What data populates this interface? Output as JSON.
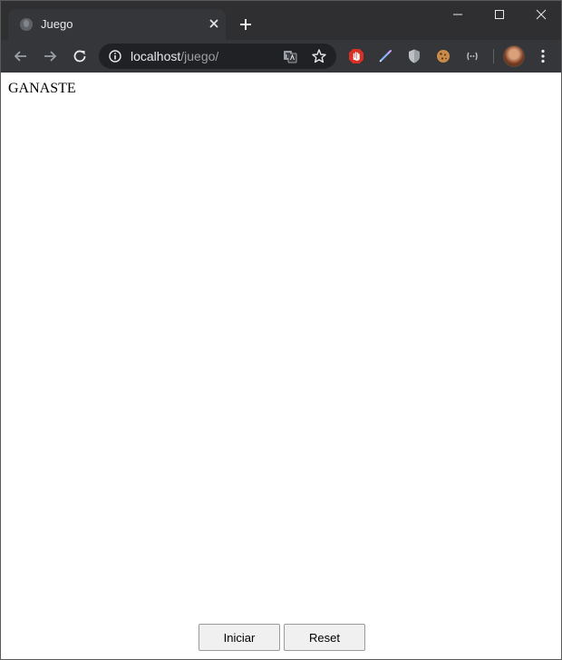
{
  "browser": {
    "tab": {
      "title": "Juego"
    },
    "omnibox": {
      "host": "localhost",
      "path": "/juego/"
    },
    "colors": {
      "frame": "#2f2f31",
      "toolbar": "#35363a",
      "omnibox": "#202124",
      "text": "#e8eaed",
      "muted": "#9aa0a6",
      "adblock_red": "#d93025"
    },
    "icons": {
      "favicon": "globe-icon",
      "close": "close-icon",
      "new_tab": "plus-icon",
      "back": "arrow-left-icon",
      "forward": "arrow-right-icon",
      "reload": "reload-icon",
      "info": "info-icon",
      "translate": "translate-icon",
      "bookmark": "star-icon",
      "extensions": [
        "adblock-hand-icon",
        "pen-icon",
        "shield-icon",
        "cookie-icon",
        "code-icon"
      ],
      "profile": "avatar",
      "menu": "kebab-menu-icon"
    }
  },
  "page": {
    "status": "GANASTE",
    "buttons": {
      "start_label": "Iniciar",
      "reset_label": "Reset"
    }
  }
}
